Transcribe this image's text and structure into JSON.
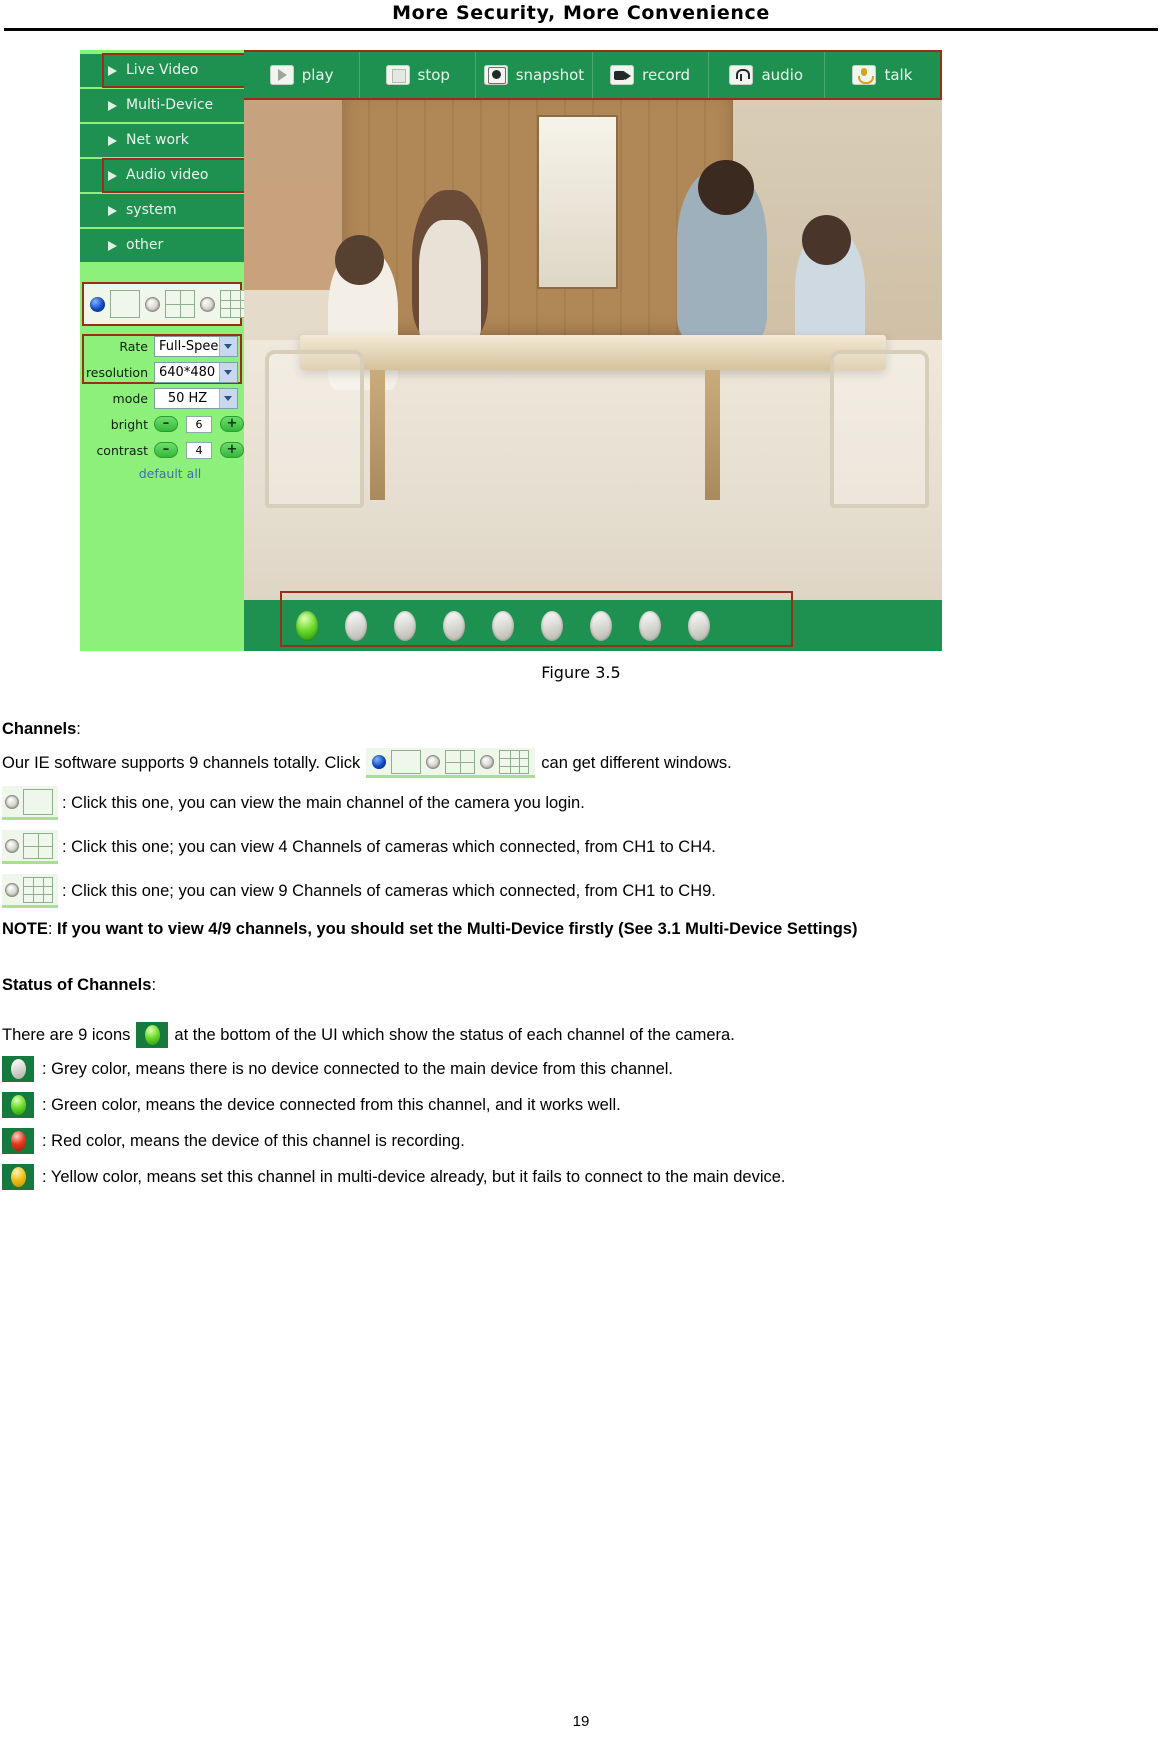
{
  "header": {
    "title": "More Security, More Convenience"
  },
  "figure": {
    "caption": "Figure 3.5",
    "menu": [
      {
        "label": "Live Video",
        "highlighted": true
      },
      {
        "label": "Multi-Device",
        "highlighted": false
      },
      {
        "label": "Net work",
        "highlighted": false
      },
      {
        "label": "Audio video",
        "highlighted": true
      },
      {
        "label": "system",
        "highlighted": false
      },
      {
        "label": "other",
        "highlighted": false
      }
    ],
    "toolbar": [
      {
        "label": "play",
        "icon": "play-icon"
      },
      {
        "label": "stop",
        "icon": "stop-icon"
      },
      {
        "label": "snapshot",
        "icon": "camera-icon"
      },
      {
        "label": "record",
        "icon": "video-camera-icon"
      },
      {
        "label": "audio",
        "icon": "headphone-icon"
      },
      {
        "label": "talk",
        "icon": "microphone-icon"
      }
    ],
    "settings": {
      "rate_label": "Rate",
      "rate_value": "Full-Spee",
      "resolution_label": "resolution",
      "resolution_value": "640*480",
      "mode_label": "mode",
      "mode_value": "50 HZ",
      "bright_label": "bright",
      "bright_value": "6",
      "contrast_label": "contrast",
      "contrast_value": "4",
      "minus_label": "–",
      "plus_label": "+",
      "default_all_label": "default all"
    },
    "status_channels": 9,
    "active_channel_index": 0
  },
  "content": {
    "channels_heading": "Channels",
    "channels_heading_colon": ":",
    "supports_prefix": "Our IE software supports 9 channels totally. Click",
    "supports_suffix": "can get different windows.",
    "opt_single": ": Click this one, you can view the main channel of the camera you login.",
    "opt_four": ": Click this one; you can view 4 Channels of cameras which connected, from CH1 to CH4.",
    "opt_nine": ": Click this one; you can view 9 Channels of cameras which connected, from CH1 to CH9.",
    "note_label": "NOTE",
    "note_colon": ": ",
    "note_body": "If you want to view 4/9 channels, you should set the Multi-Device firstly (See 3.1 Multi-Device Settings)",
    "status_heading": "Status of Channels",
    "status_heading_colon": ":",
    "status_intro_prefix": "There are 9 icons",
    "status_intro_suffix": "at the bottom of the UI which show the status of each channel of the camera.",
    "status_grey": ": Grey color, means there is no device connected to the main device from this channel.",
    "status_green": ": Green color, means the device connected from this channel, and it works well.",
    "status_red": ": Red color, means the device of this channel is recording.",
    "status_yellow": ": Yellow color, means set this channel in multi-device already, but it fails to connect to the main device."
  },
  "footer": {
    "page_number": "19"
  },
  "colors": {
    "menu_green": "#1e9150",
    "panel_green": "#8cf07a",
    "highlight_red": "#96301a",
    "link_blue": "#3f6fb0"
  }
}
